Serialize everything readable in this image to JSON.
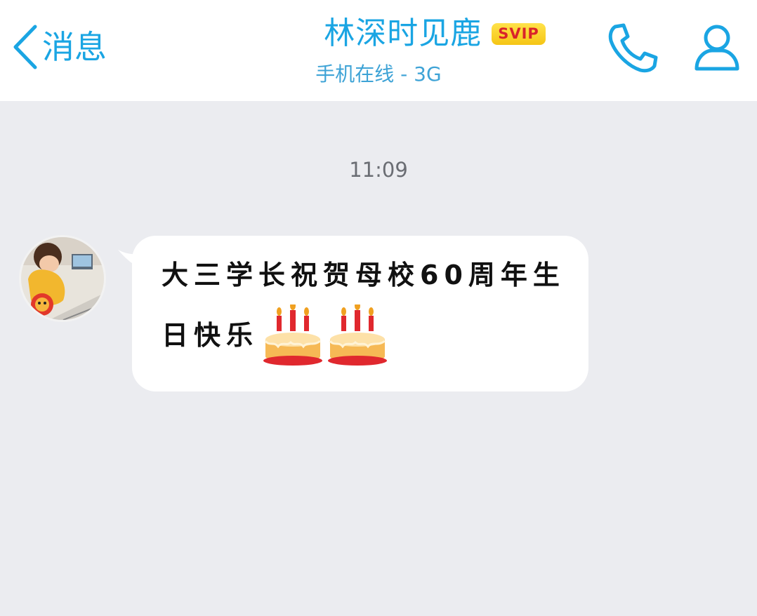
{
  "header": {
    "back_label": "消息",
    "contact_name": "林深时见鹿",
    "vip_badge": "SVIP",
    "status": "手机在线 - 3G"
  },
  "icons": {
    "back": "chevron-left-icon",
    "call": "phone-icon",
    "profile": "person-icon",
    "emoji": "birthday-cake-emoji"
  },
  "chat": {
    "timestamp": "11:09",
    "messages": [
      {
        "sender": "contact",
        "text_line1": "大三学长祝贺母校60周年生",
        "text_line2": "日快乐",
        "emoji_count": 2
      }
    ]
  },
  "colors": {
    "accent": "#1aa5e3",
    "background": "#ebecf0",
    "bubble": "#ffffff",
    "svip_bg": "#f5c515",
    "svip_text": "#d9232a"
  }
}
